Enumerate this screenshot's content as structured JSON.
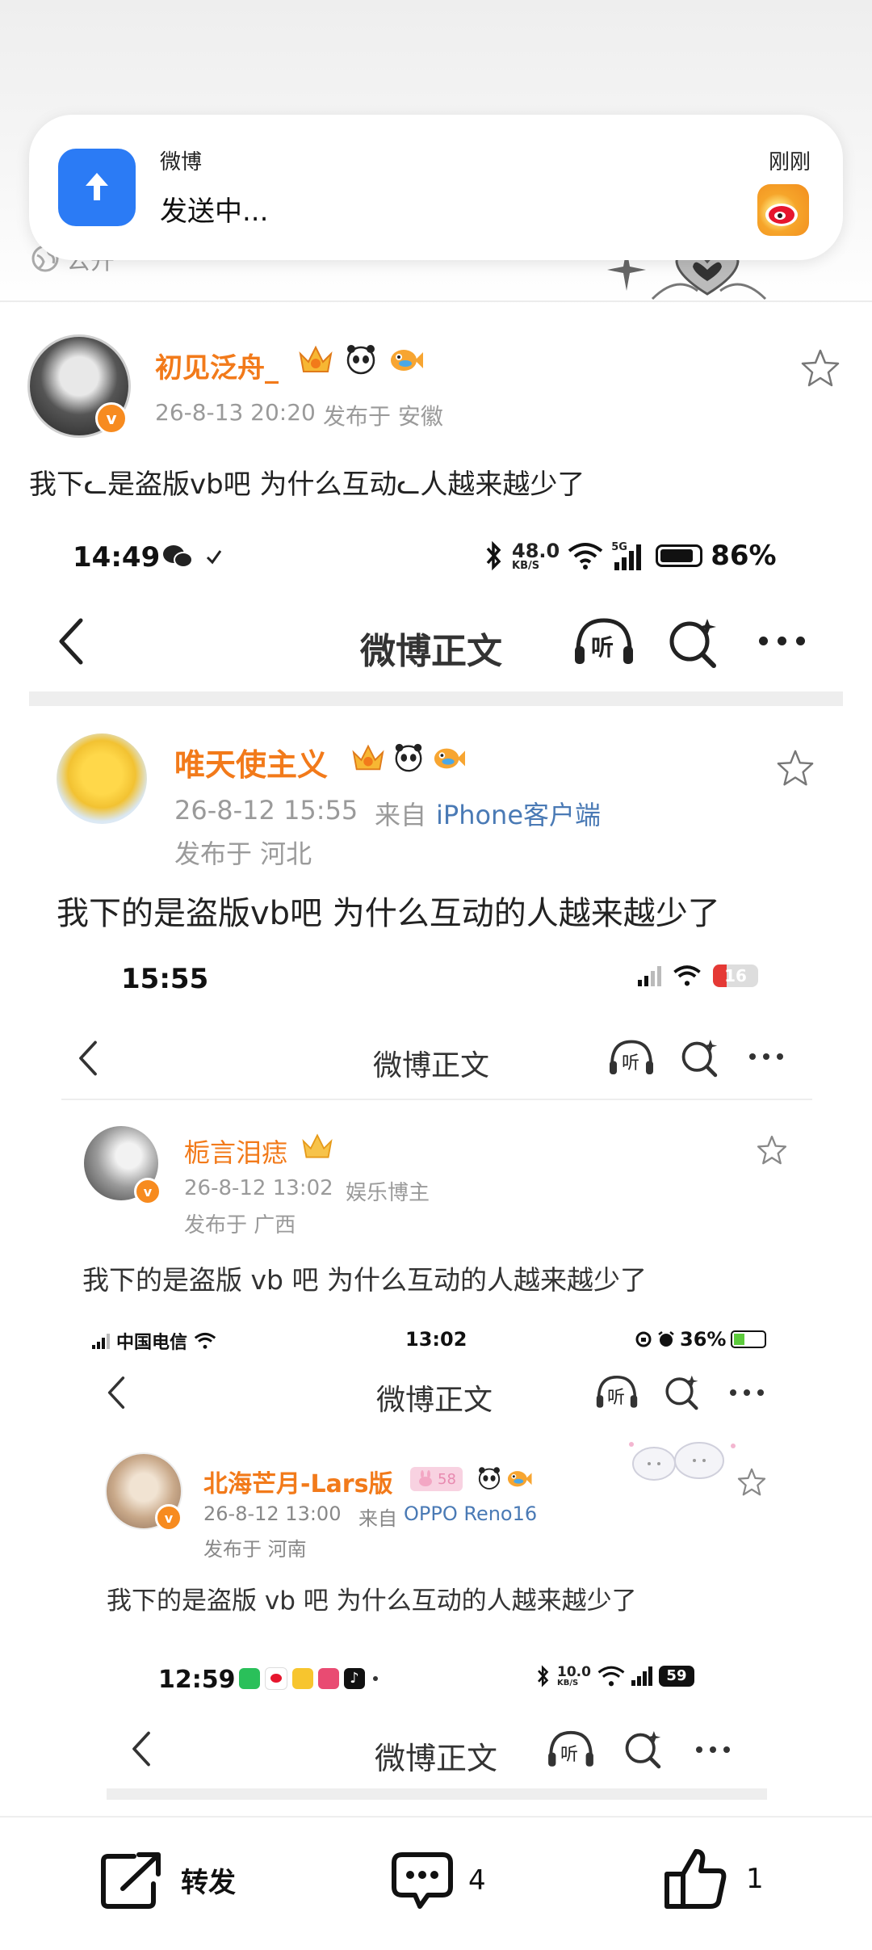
{
  "notification": {
    "app_name": "微博",
    "message": "发送中...",
    "time": "刚刚"
  },
  "public_label": "公开",
  "main_post": {
    "username": "初见泛舟_",
    "timestamp": "26-8-13 20:20",
    "location": "发布于 安徽",
    "text": "我下ᓚ是盗版vb吧 为什么互动ᓚ人越来越少了"
  },
  "shot1": {
    "status_time": "14:49",
    "net_speed": "48.0",
    "net_unit": "KB/S",
    "network": "5G",
    "battery": "86%",
    "nav_title": "微博正文",
    "listen_label": "听",
    "username": "唯天使主义",
    "timestamp": "26-8-12 15:55",
    "from_label": "来自",
    "device": "iPhone客户端",
    "location": "发布于 河北",
    "text": "我下的是盗版vb吧 为什么互动的人越来越少了"
  },
  "shot2": {
    "status_time": "15:55",
    "battery": "16",
    "nav_title": "微博正文",
    "listen_label": "听",
    "username": "栀言泪痣",
    "timestamp": "26-8-12 13:02",
    "tag": "娱乐博主",
    "location": "发布于 广西",
    "text": "我下的是盗版 vb 吧 为什么互动的人越来越少了"
  },
  "shot3": {
    "carrier": "中国电信",
    "status_time": "13:02",
    "battery": "36%",
    "nav_title": "微博正文",
    "listen_label": "听",
    "username": "北海芒月-Lars版",
    "level_badge": "58",
    "timestamp": "26-8-12 13:00",
    "from_label": "来自",
    "device": "OPPO Reno16",
    "location": "发布于 河南",
    "text": "我下的是盗版 vb 吧 为什么互动的人越来越少了"
  },
  "shot4": {
    "status_time": "12:59",
    "net_speed": "10.0",
    "net_unit": "KB/S",
    "battery": "59",
    "nav_title": "微博正文",
    "listen_label": "听"
  },
  "bottom_bar": {
    "repost_label": "转发",
    "comment_count": "4",
    "like_count": "1"
  },
  "colors": {
    "username": "#f27a1a",
    "link_blue": "#4a7ab5",
    "app_blue": "#2b7bf5"
  }
}
